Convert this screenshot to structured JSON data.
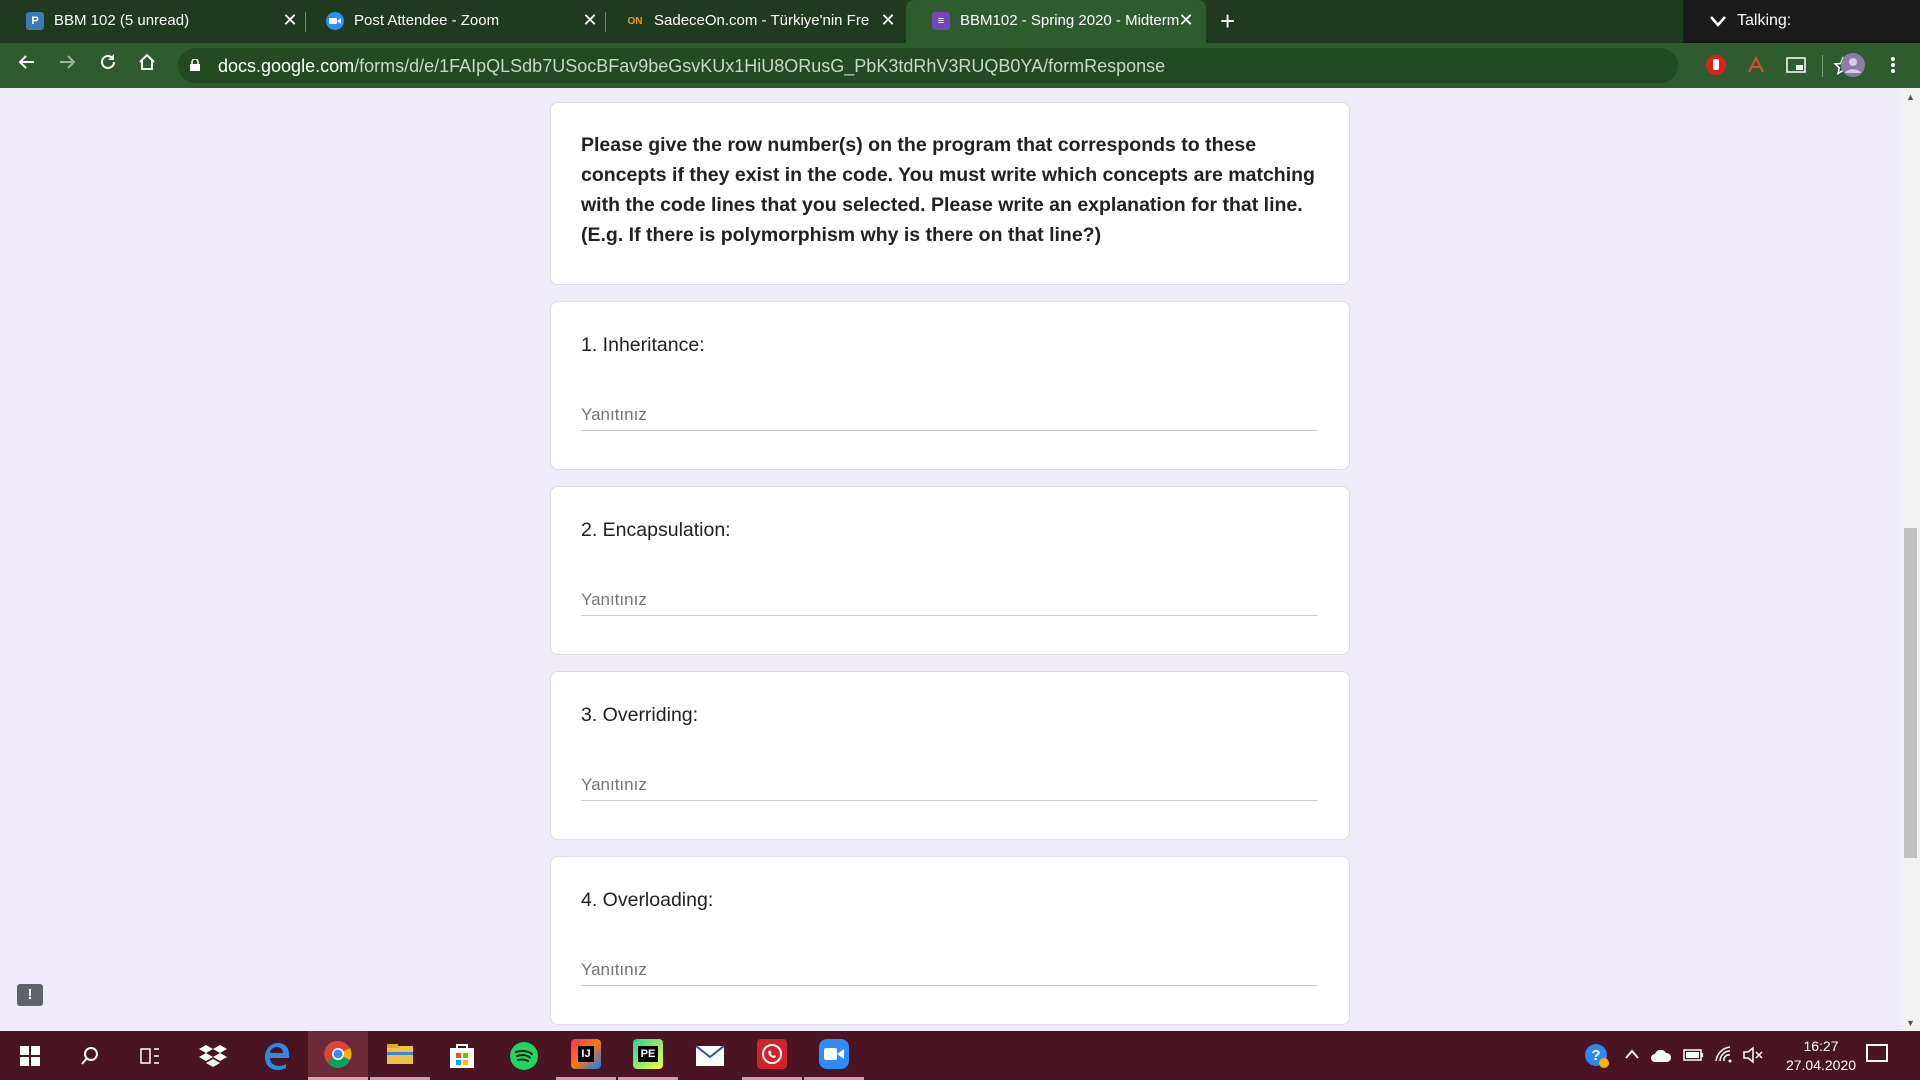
{
  "browser": {
    "tabs": [
      {
        "title": "BBM 102 (5 unread)",
        "favicon": "piazza-icon",
        "favicon_text": "P"
      },
      {
        "title": "Post Attendee - Zoom",
        "favicon": "zoom-icon",
        "favicon_text": ""
      },
      {
        "title": "SadeceOn.com - Türkiye'nin Free",
        "favicon": "sadeceon-icon",
        "favicon_text": "ON"
      },
      {
        "title": "BBM102 - Spring 2020 - Midterm",
        "favicon": "google-forms-icon",
        "favicon_text": "≡"
      }
    ],
    "new_tab": "+",
    "close_glyph": "✕",
    "url_host": "docs.google.com",
    "url_path": "/forms/d/e/1FAIpQLSdb7USocBFav9beGsvKUx1HiU8ORusG_PbK3tdRhV3RUQB0YA/formResponse",
    "zoom_banner": "Talking:"
  },
  "form": {
    "description": "Please give the row number(s) on the program that corresponds to these concepts if they exist in the code. You must write which concepts are matching with the code lines that you selected. Please write an explanation for that line. (E.g. If there is polymorphism why is there on that line?)",
    "questions": [
      {
        "title": "1. Inheritance:",
        "placeholder": "Yanıtınız"
      },
      {
        "title": "2. Encapsulation:",
        "placeholder": "Yanıtınız"
      },
      {
        "title": "3. Overriding:",
        "placeholder": "Yanıtınız"
      },
      {
        "title": "4. Overloading:",
        "placeholder": "Yanıtınız"
      }
    ],
    "feedback_glyph": "!"
  },
  "taskbar": {
    "apps": [
      "start-icon",
      "search-icon",
      "task-view-icon",
      "dropbox-icon",
      "edge-icon",
      "chrome-icon",
      "file-explorer-icon",
      "store-icon",
      "spotify-icon",
      "intellij-icon",
      "pycharm-icon",
      "mail-icon",
      "whatsapp-icon",
      "zoom-icon"
    ],
    "intellij_text": "IJ",
    "pycharm_text": "PE",
    "time": "16:27",
    "date": "27.04.2020"
  }
}
